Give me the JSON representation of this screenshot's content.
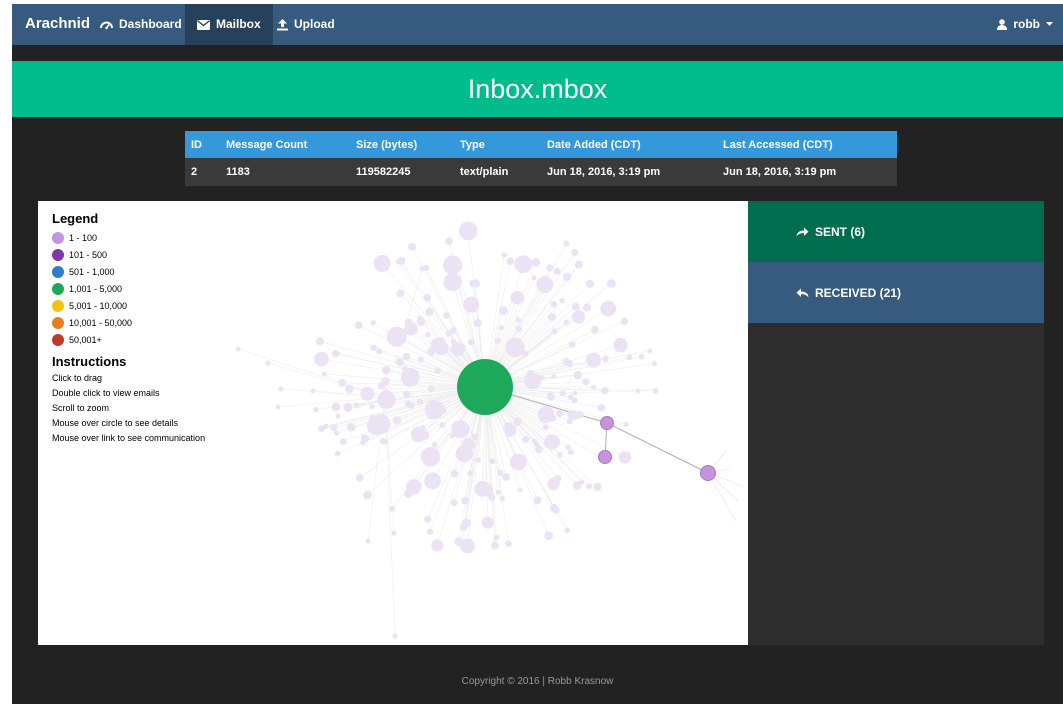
{
  "navbar": {
    "brand": "Arachnid",
    "items": [
      {
        "label": "Dashboard",
        "icon": "dashboard-icon"
      },
      {
        "label": "Mailbox",
        "icon": "envelope-icon",
        "active": true
      },
      {
        "label": "Upload",
        "icon": "upload-icon"
      }
    ],
    "user": "robb"
  },
  "page_title": "Inbox.mbox",
  "mailbox_table": {
    "headers": [
      "ID",
      "Message Count",
      "Size (bytes)",
      "Type",
      "Date Added (CDT)",
      "Last Accessed (CDT)"
    ],
    "rows": [
      [
        "2",
        "1183",
        "119582245",
        "text/plain",
        "Jun 18, 2016, 3:19 pm",
        "Jun 18, 2016, 3:19 pm"
      ]
    ]
  },
  "legend": {
    "title": "Legend",
    "items": [
      {
        "label": "1 - 100",
        "color": "#c693de"
      },
      {
        "label": "101 - 500",
        "color": "#7b3aa8"
      },
      {
        "label": "501 - 1,000",
        "color": "#2d7fc7"
      },
      {
        "label": "1,001 - 5,000",
        "color": "#1ea85a"
      },
      {
        "label": "5,001 - 10,000",
        "color": "#f1c40f"
      },
      {
        "label": "10,001 - 50,000",
        "color": "#e67e22"
      },
      {
        "label": "50,001+",
        "color": "#c0392b"
      }
    ]
  },
  "instructions": {
    "title": "Instructions",
    "lines": [
      "Click to drag",
      "Double click to view emails",
      "Scroll to zoom",
      "Mouse over circle to see details",
      "Mouse over link to see communication"
    ]
  },
  "side_panel": {
    "sent_label": "SENT (6)",
    "received_label": "RECEIVED (21)"
  },
  "colors": {
    "navbar": "#375a7f",
    "banner": "#00bc8c",
    "table_header": "#3498db",
    "sent": "#006d4f",
    "received": "#375a7f",
    "central_node": "#1ea85a",
    "small_node": "#c693de"
  },
  "footer": "Copyright © 2016 | Robb Krasnow"
}
